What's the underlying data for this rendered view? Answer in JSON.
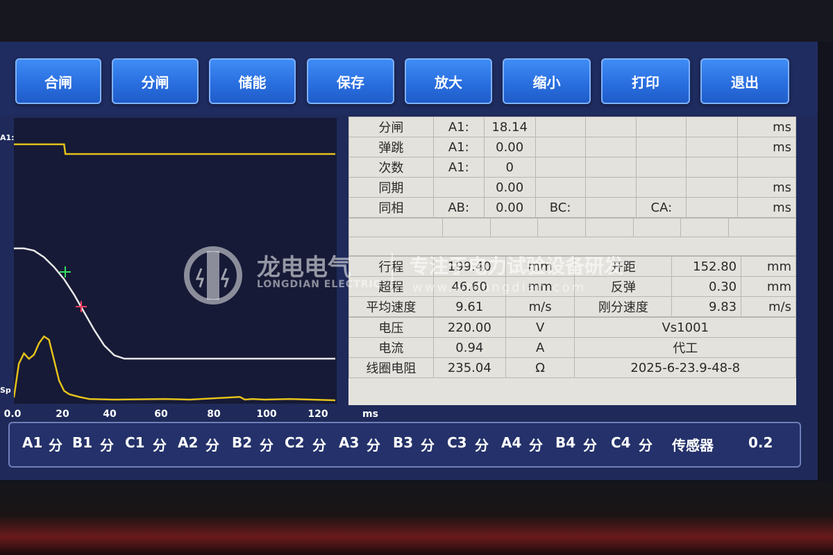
{
  "toolbar": {
    "buttons": [
      "合闸",
      "分闸",
      "储能",
      "保存",
      "放大",
      "缩小",
      "打印",
      "退出"
    ]
  },
  "chart_data": {
    "type": "line",
    "xlabel": "ms",
    "xticks": [
      "0.0",
      "20",
      "40",
      "60",
      "80",
      "100",
      "120"
    ],
    "xlim": [
      0,
      128
    ],
    "channel_labels": [
      "A1:",
      "Sp"
    ],
    "series": [
      {
        "name": "A1:",
        "color": "#e6c21a",
        "x": [
          0,
          20,
          20.5,
          128
        ],
        "y": [
          1,
          1,
          0,
          0
        ]
      },
      {
        "color": "#e8e8e8",
        "x": [
          0,
          4,
          8,
          12,
          16,
          20,
          24,
          28,
          32,
          36,
          40,
          44,
          128
        ],
        "y": [
          1.0,
          1.0,
          0.98,
          0.92,
          0.83,
          0.72,
          0.58,
          0.42,
          0.26,
          0.12,
          0.03,
          0.0,
          0.0
        ]
      },
      {
        "name": "Sp",
        "color": "#e6c21a",
        "x": [
          0,
          2,
          4,
          6,
          8,
          10,
          12,
          14,
          16,
          18,
          20,
          22,
          26,
          30,
          40,
          60,
          70,
          90,
          92,
          95,
          100,
          110,
          128
        ],
        "y": [
          0.05,
          0.55,
          0.7,
          0.62,
          0.68,
          0.85,
          0.95,
          0.9,
          0.6,
          0.3,
          0.15,
          0.1,
          0.06,
          0.03,
          0.02,
          0.03,
          0.02,
          0.06,
          0.02,
          0.03,
          0.02,
          0.03,
          0.01
        ]
      }
    ]
  },
  "table": {
    "top_rows": [
      [
        "分闸",
        "A1:",
        "18.14",
        "",
        "",
        "",
        "",
        "ms"
      ],
      [
        "弹跳",
        "A1:",
        "0.00",
        "",
        "",
        "",
        "",
        "ms"
      ],
      [
        "次数",
        "A1:",
        "0",
        "",
        "",
        "",
        "",
        ""
      ],
      [
        "同期",
        "",
        "0.00",
        "",
        "",
        "",
        "",
        "ms"
      ],
      [
        "同相",
        "AB:",
        "0.00",
        "BC:",
        "",
        "CA:",
        "",
        "ms"
      ]
    ],
    "stroke": [
      [
        "行程",
        "199.40",
        "mm",
        "开距",
        "152.80",
        "mm"
      ],
      [
        "超程",
        "46.60",
        "mm",
        "反弹",
        "0.30",
        "mm"
      ],
      [
        "平均速度",
        "9.61",
        "m/s",
        "刚分速度",
        "9.83",
        "m/s"
      ]
    ],
    "electrical": [
      [
        "电压",
        "220.00",
        "V",
        "Vs1001"
      ],
      [
        "电流",
        "0.94",
        "A",
        "代工"
      ],
      [
        "线圈电阻",
        "235.04",
        "Ω",
        "2025-6-23.9-48-8"
      ]
    ]
  },
  "channels": {
    "items": [
      "A1",
      "分",
      "B1",
      "分",
      "C1",
      "分",
      "A2",
      "分",
      "B2",
      "分",
      "C2",
      "分",
      "A3",
      "分",
      "B3",
      "分",
      "C3",
      "分",
      "A4",
      "分",
      "B4",
      "分",
      "C4",
      "分",
      "传感器",
      "0.2"
    ]
  },
  "watermark": {
    "brand": "龙电电气",
    "brand_en": "LONGDIAN ELECTRIC",
    "slogan": "专注于电力试验设备研发",
    "url": "www.whlongdian.com"
  }
}
